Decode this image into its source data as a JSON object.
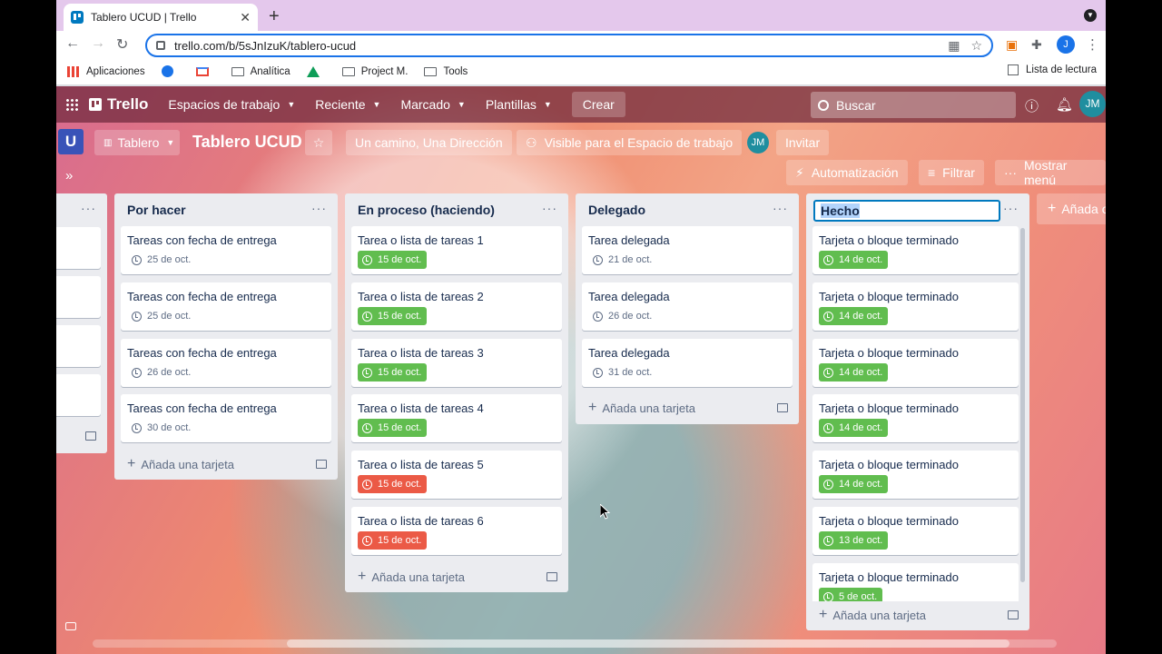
{
  "browser": {
    "tab_title": "Tablero UCUD | Trello",
    "url": "trello.com/b/5sJnIzuK/tablero-ucud",
    "profile_initial": "J",
    "bookmarks": [
      "Aplicaciones",
      "",
      "",
      "Analítica",
      "",
      "Project M.",
      "Tools"
    ],
    "reading_list": "Lista de lectura"
  },
  "header": {
    "logo": "Trello",
    "menus": [
      "Espacios de trabajo",
      "Reciente",
      "Marcado",
      "Plantillas"
    ],
    "create": "Crear",
    "search_placeholder": "Buscar",
    "avatar": "JM"
  },
  "board": {
    "workspace_initial": "U",
    "view": "Tablero",
    "title": "Tablero UCUD",
    "workspace_name": "Un camino, Una Dirección",
    "visibility": "Visible para el Espacio de trabajo",
    "member_avatar": "JM",
    "invite": "Invitar",
    "automation": "Automatización",
    "filter": "Filtrar",
    "menu": "Mostrar menú",
    "add_list": "Añada otra lista"
  },
  "lists": [
    {
      "title": "Por hacer",
      "add": "Añada una tarjeta",
      "cards": [
        {
          "title": "Tareas con fecha de entrega",
          "date": "25 de oct.",
          "status": "none"
        },
        {
          "title": "Tareas con fecha de entrega",
          "date": "25 de oct.",
          "status": "none"
        },
        {
          "title": "Tareas con fecha de entrega",
          "date": "26 de oct.",
          "status": "none"
        },
        {
          "title": "Tareas con fecha de entrega",
          "date": "30 de oct.",
          "status": "none"
        }
      ]
    },
    {
      "title": "En proceso (haciendo)",
      "add": "Añada una tarjeta",
      "cards": [
        {
          "title": "Tarea o lista de tareas 1",
          "date": "15 de oct.",
          "status": "green"
        },
        {
          "title": "Tarea o lista de tareas 2",
          "date": "15 de oct.",
          "status": "green"
        },
        {
          "title": "Tarea o lista de tareas 3",
          "date": "15 de oct.",
          "status": "green"
        },
        {
          "title": "Tarea o lista de tareas 4",
          "date": "15 de oct.",
          "status": "green"
        },
        {
          "title": "Tarea o lista de tareas 5",
          "date": "15 de oct.",
          "status": "red"
        },
        {
          "title": "Tarea o lista de tareas 6",
          "date": "15 de oct.",
          "status": "red"
        }
      ]
    },
    {
      "title": "Delegado",
      "add": "Añada una tarjeta",
      "cards": [
        {
          "title": "Tarea delegada",
          "date": "21 de oct.",
          "status": "none"
        },
        {
          "title": "Tarea delegada",
          "date": "26 de oct.",
          "status": "none"
        },
        {
          "title": "Tarea delegada",
          "date": "31 de oct.",
          "status": "none"
        }
      ]
    },
    {
      "title": "Hecho",
      "add": "Añada una tarjeta",
      "cards": [
        {
          "title": "Tarjeta o bloque terminado",
          "date": "14 de oct.",
          "status": "green"
        },
        {
          "title": "Tarjeta o bloque terminado",
          "date": "14 de oct.",
          "status": "green"
        },
        {
          "title": "Tarjeta o bloque terminado",
          "date": "14 de oct.",
          "status": "green"
        },
        {
          "title": "Tarjeta o bloque terminado",
          "date": "14 de oct.",
          "status": "green"
        },
        {
          "title": "Tarjeta o bloque terminado",
          "date": "14 de oct.",
          "status": "green"
        },
        {
          "title": "Tarjeta o bloque terminado",
          "date": "13 de oct.",
          "status": "green"
        },
        {
          "title": "Tarjeta o bloque terminado",
          "date": "5 de oct.",
          "status": "green"
        }
      ]
    }
  ],
  "colors": {
    "green": "#61bd4f",
    "red": "#eb5a46",
    "primary": "#0079bf"
  }
}
